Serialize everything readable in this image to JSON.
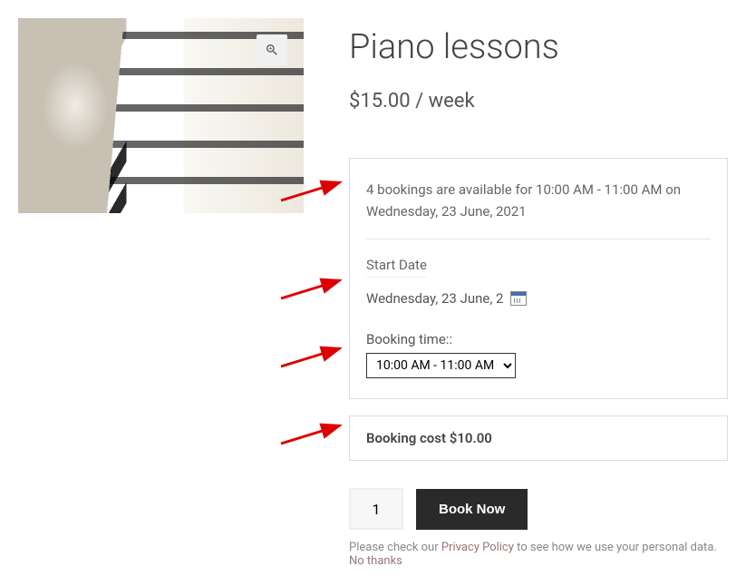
{
  "product": {
    "title": "Piano lessons",
    "price": "$15.00 / week"
  },
  "booking": {
    "availability": "4 bookings are available for 10:00 AM - 11:00 AM on Wednesday, 23 June, 2021",
    "start_date_label": "Start Date",
    "start_date_value": "Wednesday, 23 June, 2",
    "booking_time_label": "Booking time::",
    "booking_time_value": "10:00 AM - 11:00 AM",
    "cost_label": "Booking cost $10.00"
  },
  "actions": {
    "quantity": "1",
    "book_label": "Book Now"
  },
  "privacy": {
    "prefix": "Please check our ",
    "link": "Privacy Policy",
    "suffix": " to see how we use your personal data. ",
    "dismiss": "No thanks"
  }
}
